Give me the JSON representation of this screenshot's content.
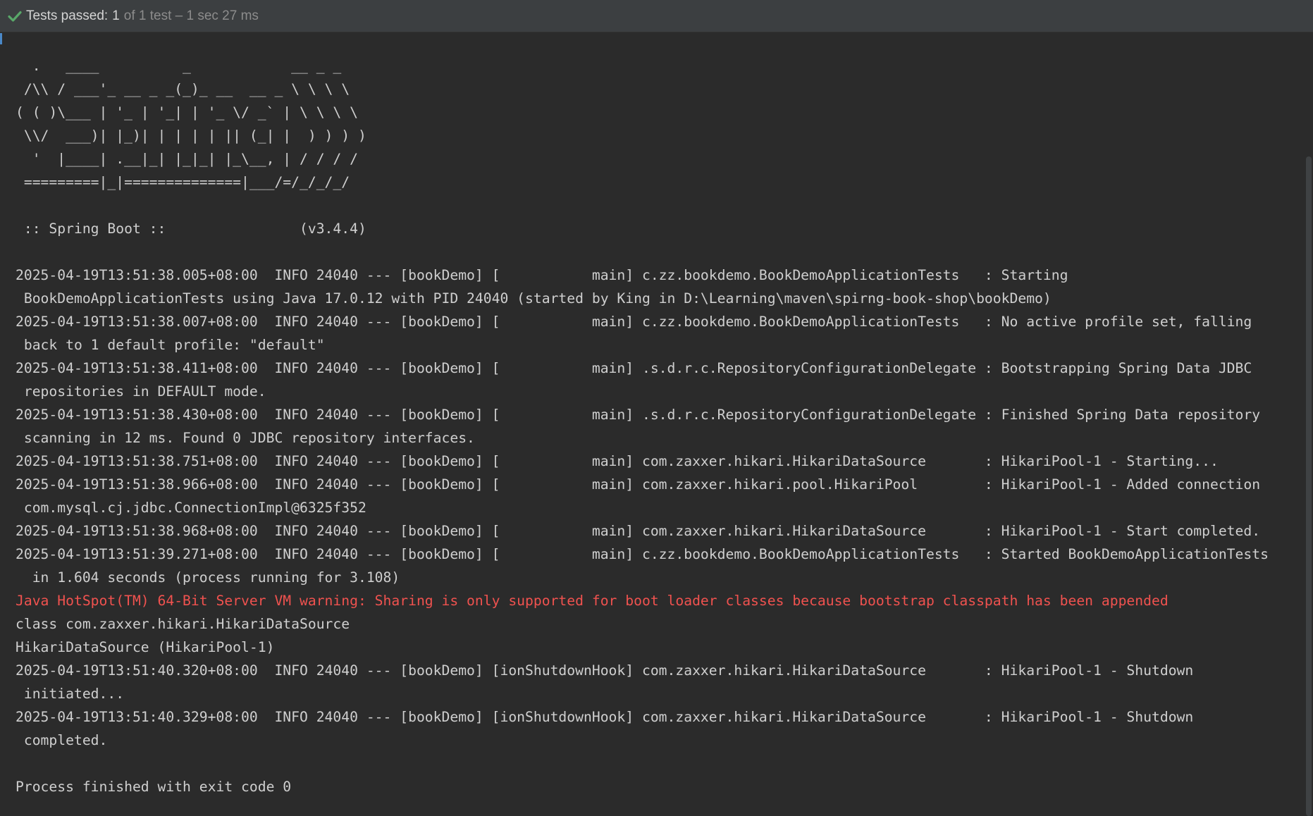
{
  "status_bar": {
    "label": "Tests passed:",
    "passed_count": "1",
    "detail": "of 1 test – 1 sec 27 ms",
    "icon": "check-icon",
    "icon_color": "#59a869"
  },
  "colors": {
    "background": "#2b2b2b",
    "text": "#cfcfcf",
    "error_text": "#f0524f"
  },
  "console": {
    "lines": [
      {
        "text": "  .   ____          _            __ _ _",
        "type": "normal"
      },
      {
        "text": " /\\\\ / ___'_ __ _ _(_)_ __  __ _ \\ \\ \\ \\",
        "type": "normal"
      },
      {
        "text": "( ( )\\___ | '_ | '_| | '_ \\/ _` | \\ \\ \\ \\",
        "type": "normal"
      },
      {
        "text": " \\\\/  ___)| |_)| | | | | || (_| |  ) ) ) )",
        "type": "normal"
      },
      {
        "text": "  '  |____| .__|_| |_|_| |_\\__, | / / / /",
        "type": "normal"
      },
      {
        "text": " =========|_|==============|___/=/_/_/_/",
        "type": "normal"
      },
      {
        "text": "",
        "type": "normal"
      },
      {
        "text": " :: Spring Boot ::                (v3.4.4)",
        "type": "normal"
      },
      {
        "text": "",
        "type": "normal"
      },
      {
        "text": "2025-04-19T13:51:38.005+08:00  INFO 24040 --- [bookDemo] [           main] c.zz.bookdemo.BookDemoApplicationTests   : Starting",
        "type": "normal"
      },
      {
        "text": " BookDemoApplicationTests using Java 17.0.12 with PID 24040 (started by King in D:\\Learning\\maven\\spirng-book-shop\\bookDemo)",
        "type": "normal"
      },
      {
        "text": "2025-04-19T13:51:38.007+08:00  INFO 24040 --- [bookDemo] [           main] c.zz.bookdemo.BookDemoApplicationTests   : No active profile set, falling",
        "type": "normal"
      },
      {
        "text": " back to 1 default profile: \"default\"",
        "type": "normal"
      },
      {
        "text": "2025-04-19T13:51:38.411+08:00  INFO 24040 --- [bookDemo] [           main] .s.d.r.c.RepositoryConfigurationDelegate : Bootstrapping Spring Data JDBC",
        "type": "normal"
      },
      {
        "text": " repositories in DEFAULT mode.",
        "type": "normal"
      },
      {
        "text": "2025-04-19T13:51:38.430+08:00  INFO 24040 --- [bookDemo] [           main] .s.d.r.c.RepositoryConfigurationDelegate : Finished Spring Data repository",
        "type": "normal"
      },
      {
        "text": " scanning in 12 ms. Found 0 JDBC repository interfaces.",
        "type": "normal"
      },
      {
        "text": "2025-04-19T13:51:38.751+08:00  INFO 24040 --- [bookDemo] [           main] com.zaxxer.hikari.HikariDataSource       : HikariPool-1 - Starting...",
        "type": "normal"
      },
      {
        "text": "2025-04-19T13:51:38.966+08:00  INFO 24040 --- [bookDemo] [           main] com.zaxxer.hikari.pool.HikariPool        : HikariPool-1 - Added connection",
        "type": "normal"
      },
      {
        "text": " com.mysql.cj.jdbc.ConnectionImpl@6325f352",
        "type": "normal"
      },
      {
        "text": "2025-04-19T13:51:38.968+08:00  INFO 24040 --- [bookDemo] [           main] com.zaxxer.hikari.HikariDataSource       : HikariPool-1 - Start completed.",
        "type": "normal"
      },
      {
        "text": "2025-04-19T13:51:39.271+08:00  INFO 24040 --- [bookDemo] [           main] c.zz.bookdemo.BookDemoApplicationTests   : Started BookDemoApplicationTests",
        "type": "normal"
      },
      {
        "text": "  in 1.604 seconds (process running for 3.108)",
        "type": "normal"
      },
      {
        "text": "Java HotSpot(TM) 64-Bit Server VM warning: Sharing is only supported for boot loader classes because bootstrap classpath has been appended",
        "type": "error"
      },
      {
        "text": "class com.zaxxer.hikari.HikariDataSource",
        "type": "normal"
      },
      {
        "text": "HikariDataSource (HikariPool-1)",
        "type": "normal"
      },
      {
        "text": "2025-04-19T13:51:40.320+08:00  INFO 24040 --- [bookDemo] [ionShutdownHook] com.zaxxer.hikari.HikariDataSource       : HikariPool-1 - Shutdown",
        "type": "normal"
      },
      {
        "text": " initiated...",
        "type": "normal"
      },
      {
        "text": "2025-04-19T13:51:40.329+08:00  INFO 24040 --- [bookDemo] [ionShutdownHook] com.zaxxer.hikari.HikariDataSource       : HikariPool-1 - Shutdown",
        "type": "normal"
      },
      {
        "text": " completed.",
        "type": "normal"
      },
      {
        "text": "",
        "type": "normal"
      },
      {
        "text": "Process finished with exit code 0",
        "type": "normal"
      }
    ]
  }
}
